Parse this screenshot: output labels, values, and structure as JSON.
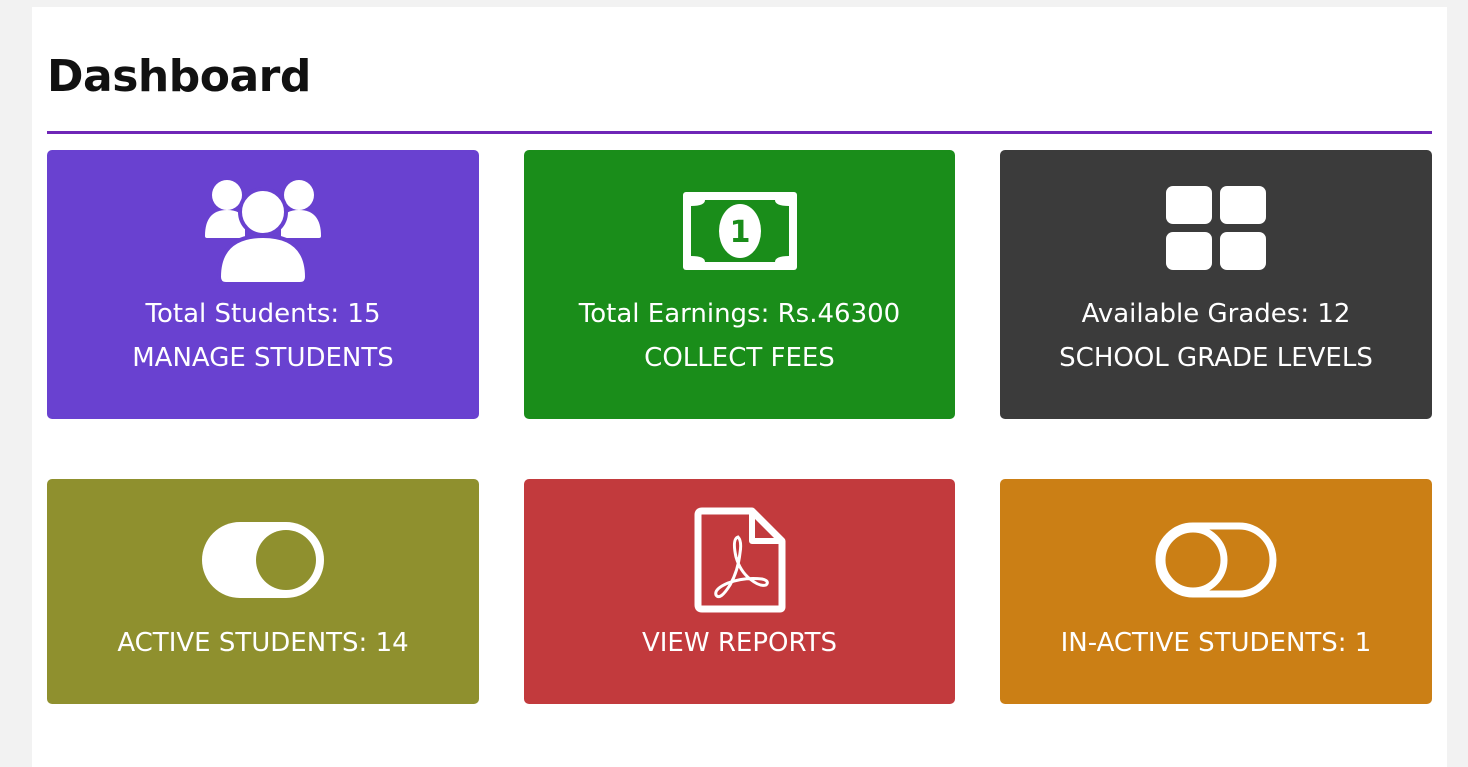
{
  "page": {
    "title": "Dashboard"
  },
  "colors": {
    "rule": "#6f26b7",
    "students_card": "#6941d0",
    "earnings_card": "#1a8d1a",
    "grades_card": "#3b3b3b",
    "active_card": "#8f902e",
    "reports_card": "#c23a3d",
    "inactive_card": "#cb7f15"
  },
  "cards": {
    "students": {
      "icon": "users-icon",
      "stat": "Total Students: 15",
      "action": "MANAGE STUDENTS"
    },
    "earnings": {
      "icon": "money-bill-icon",
      "stat": "Total Earnings: Rs.46300",
      "action": "COLLECT FEES"
    },
    "grades": {
      "icon": "grid-icon",
      "stat": "Available Grades: 12",
      "action": "SCHOOL GRADE LEVELS"
    },
    "active": {
      "icon": "toggle-on-icon",
      "label": "ACTIVE STUDENTS: 14"
    },
    "reports": {
      "icon": "pdf-file-icon",
      "label": "VIEW REPORTS"
    },
    "inactive": {
      "icon": "toggle-off-icon",
      "label": "IN-ACTIVE STUDENTS: 1"
    }
  }
}
